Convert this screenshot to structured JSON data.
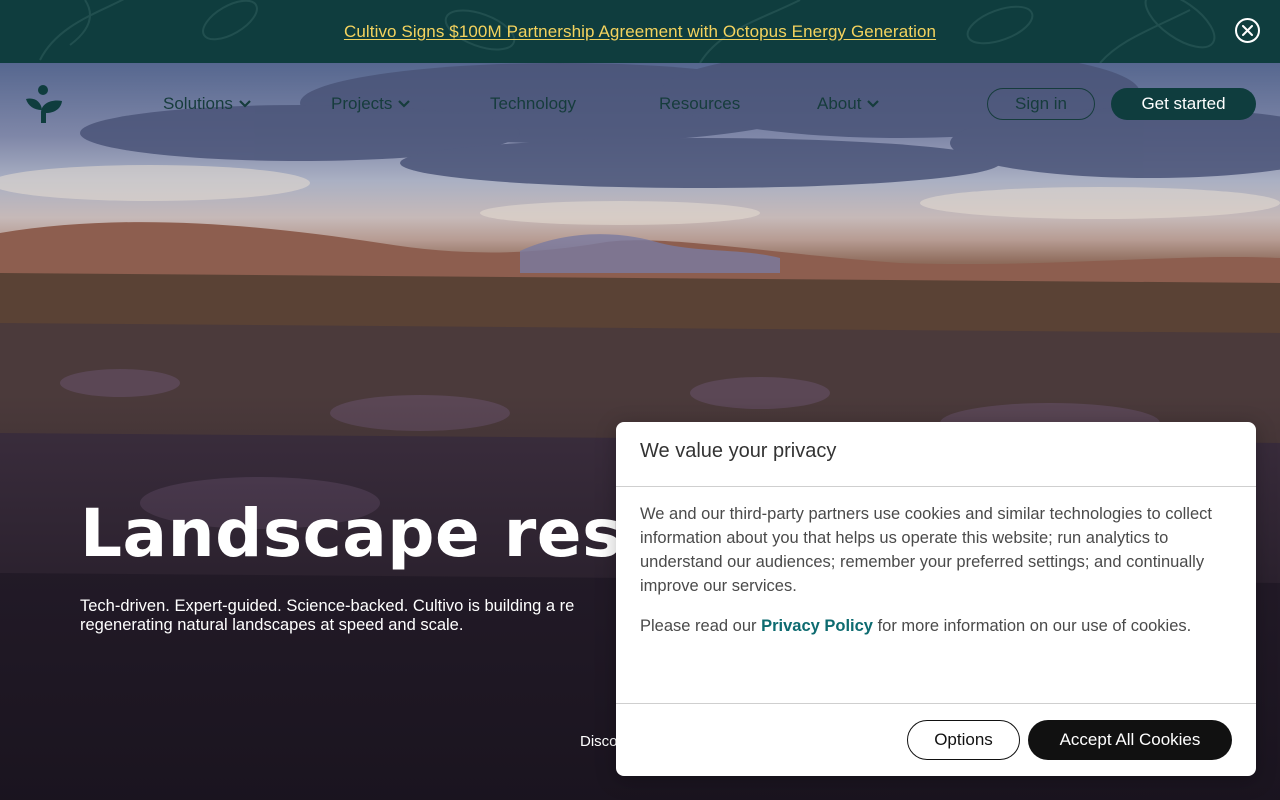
{
  "announcement": {
    "text": "Cultivo Signs $100M Partnership Agreement with Octopus Energy Generation",
    "close_icon": "close-circle-icon"
  },
  "nav": {
    "logo_icon": "cultivo-sprout-logo-icon",
    "items": [
      {
        "label": "Solutions",
        "has_dropdown": true
      },
      {
        "label": "Projects",
        "has_dropdown": true
      },
      {
        "label": "Technology",
        "has_dropdown": false
      },
      {
        "label": "Resources",
        "has_dropdown": false
      },
      {
        "label": "About",
        "has_dropdown": true
      }
    ],
    "signin_label": "Sign in",
    "get_started_label": "Get started"
  },
  "hero": {
    "title": "Landscape resil",
    "subtitle": "Tech-driven. Expert-guided. Science-backed. Cultivo is building a re regenerating natural landscapes at speed and scale.",
    "discover_label": "Disco"
  },
  "cookie_modal": {
    "title": "We value your privacy",
    "paragraph1": "We and our third-party partners use cookies and similar technologies to collect information about you that helps us operate this website; run analytics to understand our audiences; remember your preferred settings; and continually improve our services.",
    "paragraph2_before": "Please read our ",
    "privacy_link": "Privacy Policy",
    "paragraph2_after": " for more information on our use of cookies.",
    "options_label": "Options",
    "accept_label": "Accept All Cookies"
  },
  "colors": {
    "brand_dark": "#0f3d3e",
    "announcement_link": "#f4d35e",
    "privacy_link": "#0d6b70"
  }
}
